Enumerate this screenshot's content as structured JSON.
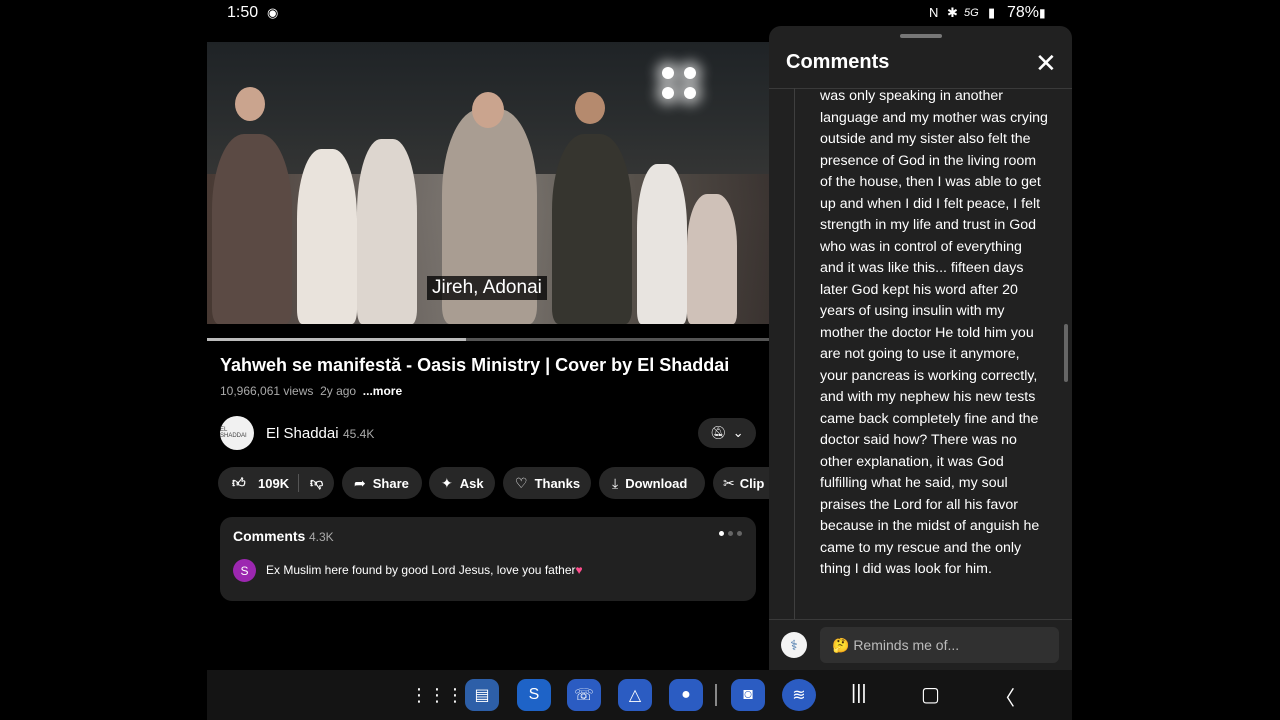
{
  "status": {
    "time": "1:50",
    "battery": "78%",
    "network": "5G"
  },
  "video": {
    "caption": "Jireh, Adonai",
    "progress_fraction": 0.46,
    "title": "Yahweh se manifestă - Oasis Ministry | Cover by El Shaddai",
    "views": "10,966,061 views",
    "age": "2y ago",
    "more": "...more"
  },
  "channel": {
    "avatar_text": "EL SHADDAI",
    "name": "El Shaddai",
    "subscribers": "45.4K"
  },
  "actions": {
    "likes": "109K",
    "share": "Share",
    "ask": "Ask",
    "thanks": "Thanks",
    "download": "Download",
    "clip": "Clip"
  },
  "comments_preview": {
    "title": "Comments",
    "count": "4.3K",
    "avatar_letter": "S",
    "text": "Ex Muslim here found by good Lord Jesus,  love you father"
  },
  "panel": {
    "title": "Comments",
    "body": "was only speaking in another language and my mother was crying outside and my sister also felt the presence of God in the living room of the house, then I was able to get up and when I did I felt peace, I felt strength in my life and trust in God who was in control of everything and it was like this... fifteen days later God kept his word after 20 years of using insulin with my mother the doctor He told him you are not going to use it anymore, your pancreas is working correctly, and with my nephew his new tests came back completely fine and the doctor said how? There was no other explanation, it was God fulfilling what he said, my soul praises the Lord for all his favor because in the midst of anguish he came to my rescue and the only thing I did was look for him.",
    "input_placeholder": "🤔 Reminds me of..."
  },
  "navbar": {
    "apps": [
      "apps-grid-icon",
      "docs-icon",
      "shazam-icon",
      "phone-icon",
      "drive-icon",
      "messages-icon",
      "camera-icon",
      "spotify-icon"
    ]
  },
  "colors": {
    "background": "#000000",
    "panel": "#212121",
    "pill": "#272727",
    "accent_heart": "#ff4d8d"
  }
}
